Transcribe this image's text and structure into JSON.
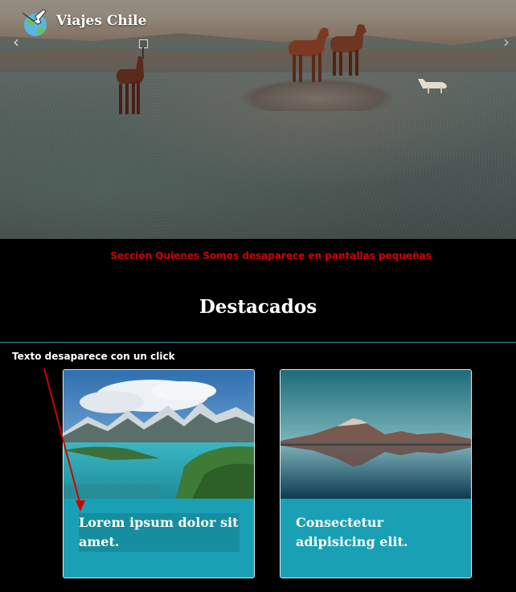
{
  "brand": {
    "name": "Viajes Chile",
    "logo_icon": "globe-plane-icon"
  },
  "hero": {
    "prev_icon": "chevron-left-icon",
    "next_icon": "chevron-right-icon",
    "prev_glyph": "‹",
    "next_glyph": "›"
  },
  "notes": {
    "section_hidden": "Sección Quienes Somos desaparece en pantallas pequeñas",
    "text_click": "Texto desaparece con un click"
  },
  "featured": {
    "title": "Destacados",
    "cards": [
      {
        "text": "Lorem ipsum dolor sit amet.",
        "image": "lake-mountains-image"
      },
      {
        "text": "Consectetur adipisicing elit.",
        "image": "volcano-reflection-image"
      }
    ]
  },
  "colors": {
    "card_bg": "#1aa0b5",
    "note_red": "#d10000",
    "divider": "#3a8fa6"
  }
}
